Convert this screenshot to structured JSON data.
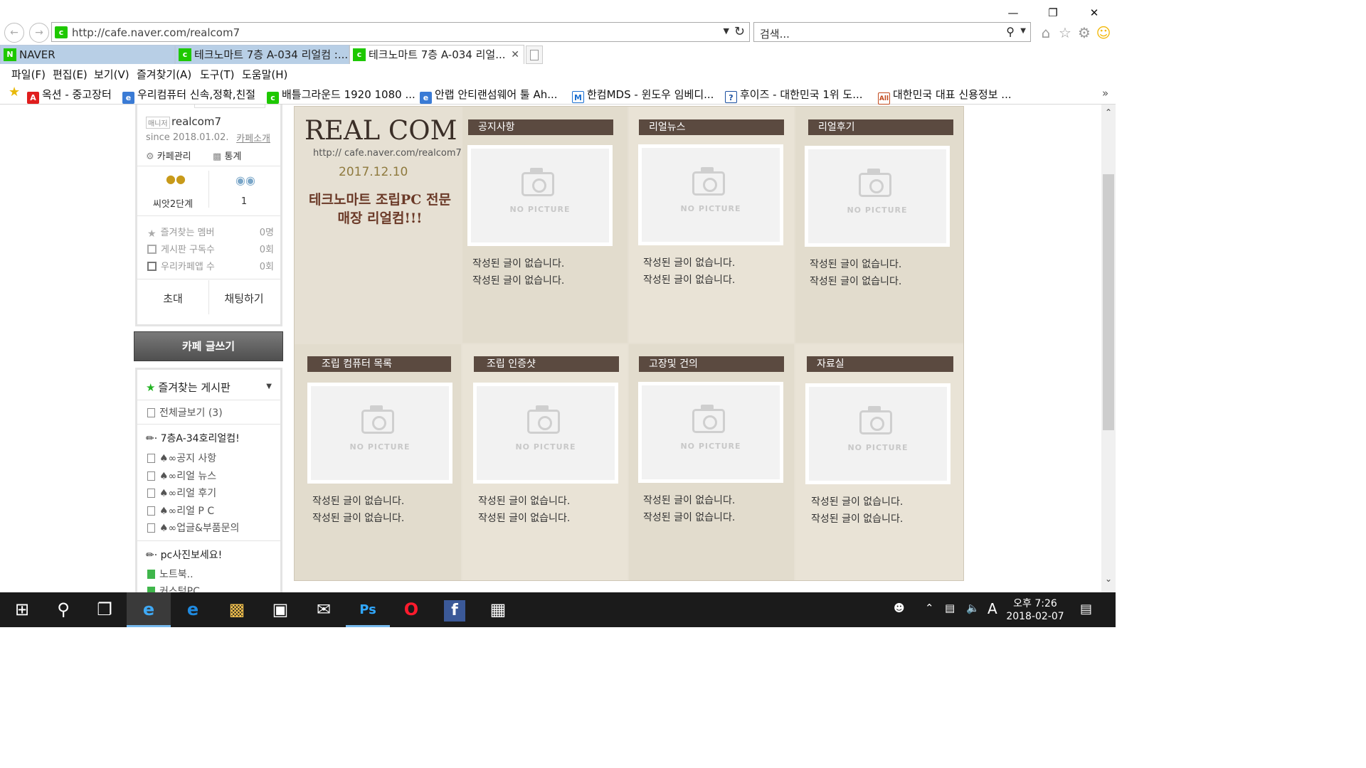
{
  "browser": {
    "url": "http://cafe.naver.com/realcom7",
    "search_placeholder": "검색...",
    "tabs": [
      {
        "label": "NAVER"
      },
      {
        "label": "테크노마트 7층 A-034 리얼컴 :..."
      },
      {
        "label": "테크노마트 7층 A-034 리얼..."
      }
    ],
    "menu": [
      "파일(F)",
      "편집(E)",
      "보기(V)",
      "즐겨찾기(A)",
      "도구(T)",
      "도움말(H)"
    ],
    "favorites": [
      {
        "label": "옥션 - 중고장터",
        "icon": "A."
      },
      {
        "label": "우리컴퓨터 신속,정확,친절",
        "icon": "ie"
      },
      {
        "label": "배틀그라운드 1920 1080 ...",
        "icon": "cafe"
      },
      {
        "label": "안랩 안티랜섬웨어 툴  Ah...",
        "icon": "ie"
      },
      {
        "label": "한컴MDS - 윈도우 임베디...",
        "icon": "M"
      },
      {
        "label": "후이즈 - 대한민국 1위 도...",
        "icon": "?"
      },
      {
        "label": "대한민국 대표 신용정보 ...",
        "icon": "All"
      }
    ]
  },
  "sidebar": {
    "manager_badge": "매니저",
    "cafe_id": "realcom7",
    "since": "since 2018.01.02.",
    "intro_link": "카페소개",
    "manage": "카페관리",
    "stats": "통계",
    "level": "씨앗2단계",
    "members": "1",
    "stat_rows": [
      {
        "label": "즐겨찾는 멤버",
        "value": "0명"
      },
      {
        "label": "게시판 구독수",
        "value": "0회"
      },
      {
        "label": "우리카페앱 수",
        "value": "0회"
      }
    ],
    "invite": "초대",
    "chat": "채팅하기",
    "write": "카페 글쓰기",
    "fav_boards": "즐겨찾는 게시판",
    "all_posts": "전체글보기 (3)",
    "group1": "7층A-34호리얼컴!",
    "group1_items": [
      "♠∞공지 사항",
      "♠∞리얼 뉴스",
      "♠∞리얼 후기",
      "♠∞리얼 P C",
      "♠∞업글&부품문의"
    ],
    "group2": "pc사진보세요!",
    "group2_items": [
      "노트북..",
      "커스텀PC .."
    ]
  },
  "main": {
    "logo": "REAL COM",
    "logo_url": "http:// cafe.naver.com/realcom7",
    "logo_date": "2017.12.10",
    "slogan": "테크노마트 조립PC 전문 매장 리얼컴!!!",
    "no_picture": "NO PICTURE",
    "empty_text": "작성된 글이 없습니다.",
    "boards": [
      "공지사항",
      "리얼뉴스",
      "리얼후기",
      "조립 컴퓨터 목록",
      "조립 인증샷",
      "고장및 건의",
      "자료실"
    ]
  },
  "taskbar": {
    "time": "오후 7:26",
    "date": "2018-02-07",
    "ime": "A"
  }
}
